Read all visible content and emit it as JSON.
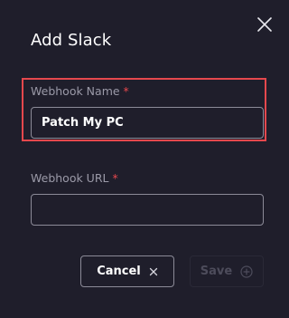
{
  "dialog": {
    "title": "Add Slack",
    "close_icon": "close-icon"
  },
  "fields": {
    "webhook_name": {
      "label": "Webhook Name",
      "required_mark": "*",
      "value": "Patch My PC",
      "placeholder": ""
    },
    "webhook_url": {
      "label": "Webhook URL",
      "required_mark": "*",
      "value": "",
      "placeholder": ""
    }
  },
  "actions": {
    "cancel_label": "Cancel",
    "cancel_icon": "x-icon",
    "save_label": "Save",
    "save_icon": "plus-circle-icon",
    "save_enabled": false
  },
  "colors": {
    "background": "#1f1e2b",
    "highlight": "#e5484d",
    "required": "#e5484d",
    "border": "#8c8b98",
    "disabled_text": "#4d4c5b"
  }
}
